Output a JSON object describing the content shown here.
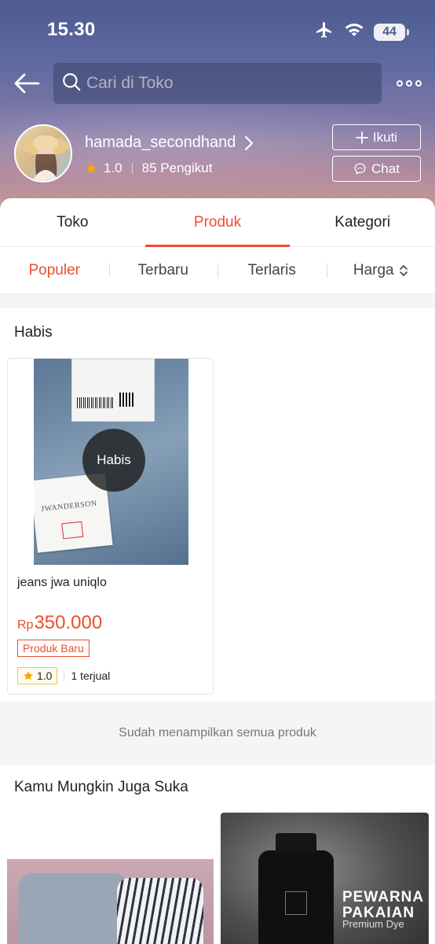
{
  "status_bar": {
    "time": "15.30",
    "battery": "44"
  },
  "search": {
    "placeholder": "Cari di Toko"
  },
  "shop": {
    "name": "hamada_secondhand",
    "rating": "1.0",
    "followers": "85 Pengikut",
    "follow_label": "Ikuti",
    "chat_label": "Chat"
  },
  "tabs": [
    {
      "label": "Toko",
      "active": false
    },
    {
      "label": "Produk",
      "active": true
    },
    {
      "label": "Kategori",
      "active": false
    }
  ],
  "sort": [
    {
      "label": "Populer",
      "active": true
    },
    {
      "label": "Terbaru",
      "active": false
    },
    {
      "label": "Terlaris",
      "active": false
    },
    {
      "label": "Harga",
      "active": false
    }
  ],
  "section": {
    "title": "Habis"
  },
  "product": {
    "overlay": "Habis",
    "name": "jeans jwa uniqlo",
    "currency": "Rp",
    "price": "350.000",
    "badge": "Produk Baru",
    "rating": "1.0",
    "sold": "1 terjual"
  },
  "end_message": "Sudah menampilkan semua produk",
  "recommendations": {
    "title": "Kamu Mungkin Juga Suka",
    "ad_title": "PEWARNA PAKAIAN",
    "ad_subtitle": "Premium Dye"
  },
  "colors": {
    "accent": "#ee4d2d",
    "star": "#f6a700"
  }
}
